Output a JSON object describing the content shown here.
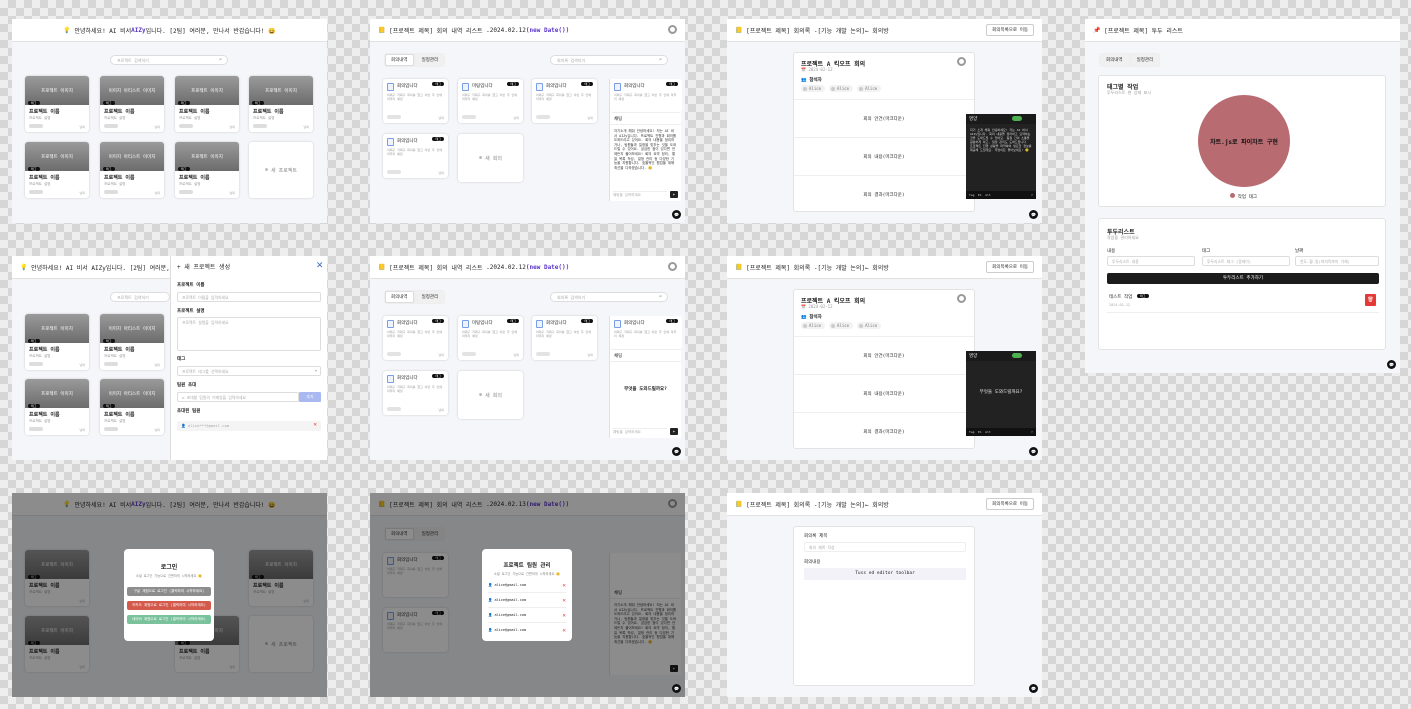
{
  "main_header": {
    "icon": "💡",
    "greet": "안녕하세요! AI 비서 ",
    "ai": "AIZy",
    "greet2": "입니다. [2팀] 여러분, 만나서 반갑습니다! 😄",
    "greet2b": "입니다. 2팀 여러분, 만나서 반갑습니다! 😄",
    "greet_cut": "안녕하세요! AI 비서 AIZy입니다. [2팀] 여러분, 만"
  },
  "search": {
    "placeholder": "프로젝트 검색하기",
    "meeting_placeholder": "회의록 검색하기"
  },
  "project": {
    "thumb_a": "프로젝트 이미지",
    "thumb_b": "이미지 아티스트 이미지",
    "thumb_c": "프로젝트 이미지",
    "tag": "태그",
    "title": "프로젝트 이름",
    "desc": "프로젝트 설명",
    "date": "날짜",
    "add": "새 프로젝트"
  },
  "meetings_header": {
    "prefix": "[프로젝트 제목] 회의 내역 리스트 - ",
    "date": "2024.02.12",
    "expr": "(new Date())",
    "date2": "2024.02.13"
  },
  "tabs": {
    "meetings": "회의내역",
    "schedule": "일정관리"
  },
  "meeting": {
    "title1": "회의입니다",
    "title2": "미팅입니다",
    "tag": "태그",
    "summary": "어쩌구 저쩌구 회의를 했고 이번 주 안에 마무리 예정",
    "date": "날짜",
    "add": "새 회의"
  },
  "chat": {
    "title": "채팅",
    "placeholder": "채팅을 입력하세요",
    "prompt": "무엇을 도와드릴까요?",
    "body": "자기소개 해줘 안녕하세요! 저는 AI 비서 AIZy입니다. 프로젝트 진행과 회의를 도와드리고 있어요. 회의 내용을 정리하거나, 팀원들과 일정을 맞추는 것을 도와드릴 수 있어요. 궁금한 점이 있다면 언제든지 물어보세요! 회의 요약 정리, 할 일 목록 작성, 일정 관리 등 다양한 기능을 지원합니다. 효율적인 협업을 위해 최선을 다하겠습니다. 😊"
  },
  "meeting_detail": {
    "header_prefix": "[프로젝트 제목] 회의록 - ",
    "header_title": "[기능 개발 논의]",
    "back": " ← 회의방",
    "button": "회의목록으로 이동",
    "title": "프로젝트 A 킥오프 회의",
    "date": "2024-02-12",
    "attendees_label": "참석자",
    "attendees": [
      "Alice",
      "Alice",
      "Alice"
    ],
    "section1": "회의 안건(마크다운)",
    "section2": "회의 내용(마크다운)",
    "section3": "회의 결과(마크다운)"
  },
  "assistant": {
    "title": "영양",
    "body": "자기 소개 해줘 안녕하세요! 저는 AI 비서 AIZy입니다. 회의 내용을 정리하고 요약하는 것을 도와드릴 수 있어요. 팀원 간의 소통을 원활하게 하고, 일정 관리도 도와드립니다. 프로젝트 진행 상황을 파악하여 필요한 정보를 제공해 드릴게요. 무엇이든 물어보세요! 😊",
    "prompt": "무엇을 도와드릴까요?",
    "f1": "Tag",
    "f2": "E1",
    "f3": "Alt"
  },
  "todo": {
    "header": "[프로젝트 제목] 투두 리스트",
    "pie_title": "태그별 작업",
    "pie_sub": "투두리스트 현 상태 표시",
    "pie_text": "차트.js로 파이차트 구현",
    "legend": "작업 태그",
    "list_title": "투두리스트",
    "list_sub": "작업을 관리하세요",
    "col_content": "내용",
    "col_tag": "태그",
    "col_due": "날짜",
    "ph_content": "투두리스트 내용",
    "ph_tag": "투두리스트 태그 (알레이)",
    "ph_due": "연도-월-일(마지막까지 기재)",
    "add": "투두리스트 추가하기",
    "item": "테스트 작업",
    "item_tag": "태그",
    "item_date": "2024-02-12"
  },
  "new_project": {
    "title": "새 프로젝트 생성",
    "name_label": "프로젝트 이름",
    "name_ph": "프로젝트 이름을 입력하세요",
    "desc_label": "프로젝트 설명",
    "desc_ph": "프로젝트 설명을 입력하세요",
    "tag_label": "태그",
    "tag_ph": "프로젝트 태그를 선택하세요",
    "invite_label": "팀원 초대",
    "invite_ph": "초대할 팀원의 이메일을 입력하세요",
    "invite_btn": "추가",
    "members_label": "초대된 팀원",
    "member": "alice***@gmail.com"
  },
  "login": {
    "title": "로그인",
    "sub": "소셜 로그인 기능으로 간편하게 시작하세요 😊",
    "b1": "구글 계정으로 로그인 (클릭하여 시작하세요)",
    "b2": "카카오 계정으로 로그인 (클릭하여 시작하세요)",
    "b3": "네이버 계정으로 로그인 (클릭하여 시작하세요)"
  },
  "members": {
    "title": "프로젝트 팀원 관리",
    "sub": "소셜 로그인 기능으로 간편하게 시작하세요 😊",
    "emails": [
      "alice@gmail.com",
      "alice@gmail.com",
      "alice@gmail.com",
      "alice@gmail.com"
    ]
  },
  "editor": {
    "title_label": "회의록 제목",
    "title_ph": "회의 제목 작성",
    "content_label": "회의내용",
    "toolbar": "Tuss ed editor toolbar"
  }
}
